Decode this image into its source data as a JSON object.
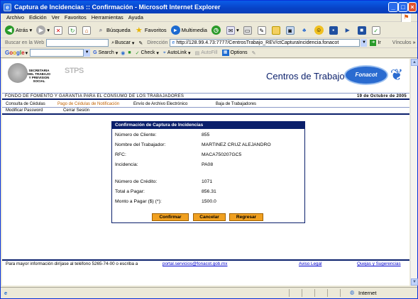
{
  "window": {
    "title": "Captura de Incidencias :: Confirmación - Microsoft Internet Explorer"
  },
  "menu": [
    "Archivo",
    "Edición",
    "Ver",
    "Favoritos",
    "Herramientas",
    "Ayuda"
  ],
  "toolbar": {
    "back": "Atrás",
    "search": "Búsqueda",
    "favorites": "Favoritos",
    "multimedia": "Multimedia"
  },
  "addressbar": {
    "search_label": "Buscar en la Web",
    "search_button": "Buscar",
    "address_label": "Dirección",
    "url": "http://128.99.4.73:7777/CentrosTrabajo_REV/ctCapturaIncidencia.fonacot",
    "go": "Ir",
    "links": "Vínculos"
  },
  "googlebar": {
    "logo": "Google",
    "search": "Search",
    "check": "Check",
    "autolink": "AutoLink",
    "autofill": "AutoFill",
    "options": "Options"
  },
  "header": {
    "stps_text": "SECRETARIA DEL TRABAJO Y PREVISION SOCIAL",
    "stps_abbr": "STPS",
    "site_title": "Centros de Trabajo",
    "fonacot": "Fonacot"
  },
  "banner": {
    "org": "FONDO DE FOMENTO Y GARANTIA PARA EL CONSUMO DE LOS TRABAJADORES",
    "date": "19 de Octubre de 2005"
  },
  "nav": {
    "row1": [
      "Consulta de Cédulas",
      "Pago de Cédulas de Notificación",
      "Envío de Archivo Electrónico",
      "Baja de Trabajadores"
    ],
    "row2": [
      "Modificar Password",
      "Cerrar Sesión"
    ]
  },
  "panel": {
    "title": "Confirmación de Captura de Incidencias",
    "fields": [
      {
        "label": "Número de Cliente:",
        "value": "855"
      },
      {
        "label": "Nombre del Trabajador:",
        "value": "MARTINEZ CRUZ ALEJANDRO"
      },
      {
        "label": "RFC:",
        "value": "MACA750207GC5"
      },
      {
        "label": "Incidencia:",
        "value": "PA08"
      },
      {
        "label": "Número de Crédito:",
        "value": "1071"
      },
      {
        "label": "Total a Pagar:",
        "value": "856.31"
      },
      {
        "label": "Monto a Pagar ($) (*):",
        "value": "1500.0"
      }
    ],
    "buttons": {
      "confirm": "Confirmar",
      "cancel": "Cancelar",
      "back": "Regresar"
    }
  },
  "footer": {
    "info": "Para mayor información diríjase al teléfono 5265-74-00 o escriba a",
    "email": "portal.servicios@fonacot.gob.mx",
    "legal": "Aviso Legal",
    "suggestions": "Quejas y Sugerencias"
  },
  "status": {
    "zone": "Internet"
  }
}
